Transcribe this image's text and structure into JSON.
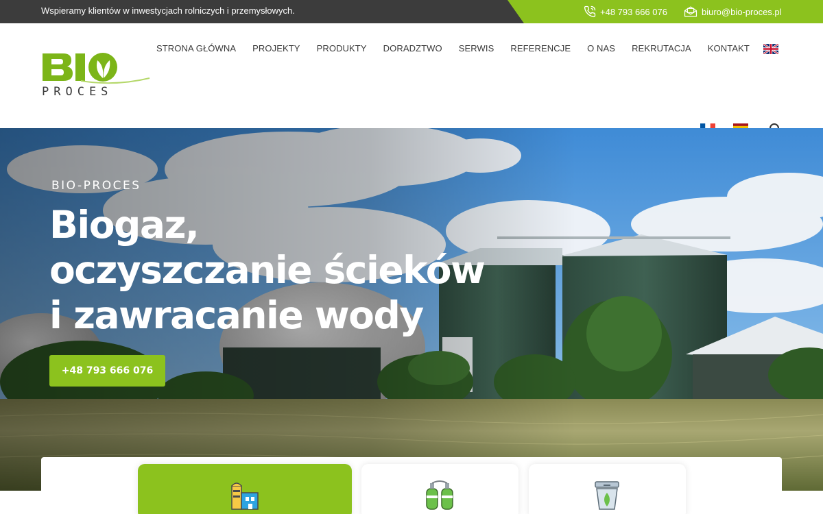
{
  "topbar": {
    "tagline": "Wspieramy klientów w inwestycjach rolniczych i przemysłowych.",
    "phone": "+48 793 666 076",
    "email": "biuro@bio-proces.pl",
    "phone_icon": "phone-icon",
    "email_icon": "envelope-icon"
  },
  "logo": {
    "word1": "BIO",
    "word2": "PROCES"
  },
  "nav": {
    "items": [
      {
        "label": "STRONA GŁÓWNA"
      },
      {
        "label": "PROJEKTY"
      },
      {
        "label": "PRODUKTY"
      },
      {
        "label": "DORADZTWO"
      },
      {
        "label": "SERWIS"
      },
      {
        "label": "REFERENCJE"
      },
      {
        "label": "O NAS"
      },
      {
        "label": "REKRUTACJA"
      },
      {
        "label": "KONTAKT"
      }
    ],
    "languages": [
      "en-flag-icon",
      "fr-flag-icon",
      "es-flag-icon"
    ],
    "search_icon": "search-icon"
  },
  "hero": {
    "eyebrow": "BIO-PROCES",
    "headline_lines": [
      "Biogaz,",
      "oczyszczanie ścieków",
      "i zawracanie wody"
    ],
    "cta_label": "+48 793 666 076"
  },
  "cards": [
    {
      "icon": "biogas-plant-icon",
      "active": true
    },
    {
      "icon": "gas-cylinders-icon",
      "active": false
    },
    {
      "icon": "water-treatment-icon",
      "active": false
    }
  ],
  "colors": {
    "brand_green": "#8cc21e",
    "topbar_dark": "#3c3c3c",
    "nav_text": "#3a3a3a"
  }
}
